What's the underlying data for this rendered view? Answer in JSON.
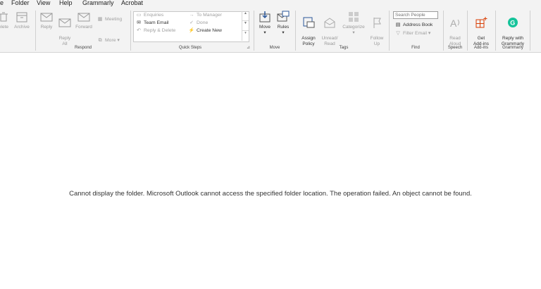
{
  "menubar": {
    "items": [
      {
        "label": "e"
      },
      {
        "label": "Folder"
      },
      {
        "label": "View"
      },
      {
        "label": "Help"
      },
      {
        "label": "Grammarly"
      },
      {
        "label": "Acrobat"
      }
    ]
  },
  "ribbon": {
    "delete": {
      "delete_label": "elete",
      "archive_label": "Archive"
    },
    "respond": {
      "reply_label": "Reply",
      "reply_all_label": "Reply\nAll",
      "forward_label": "Forward",
      "meeting_label": "Meeting",
      "more_label": "More",
      "group_label": "Respond"
    },
    "quick_steps": {
      "items": [
        {
          "label": "Enquiries"
        },
        {
          "label": "Team Email"
        },
        {
          "label": "Reply & Delete"
        },
        {
          "label": "To Manager"
        },
        {
          "label": "Done"
        },
        {
          "label": "Create New"
        }
      ],
      "group_label": "Quick Steps"
    },
    "move": {
      "move_label": "Move",
      "rules_label": "Rules",
      "group_label": "Move"
    },
    "tags": {
      "assign_policy_label": "Assign\nPolicy",
      "unread_read_label": "Unread/\nRead",
      "categorize_label": "Categorize",
      "follow_up_label": "Follow\nUp",
      "group_label": "Tags"
    },
    "find": {
      "search_people_placeholder": "Search People",
      "address_book_label": "Address Book",
      "filter_email_label": "Filter Email",
      "group_label": "Find"
    },
    "speech": {
      "read_aloud_label": "Read\nAloud",
      "group_label": "Speech"
    },
    "addins": {
      "get_addins_label": "Get\nAdd-ins",
      "group_label": "Add-ins"
    },
    "grammarly": {
      "reply_label": "Reply with\nGrammarly",
      "group_label": "Grammarly"
    }
  },
  "main": {
    "message": "Cannot display the folder. Microsoft Outlook cannot access the specified folder location. The operation failed. An object cannot be found."
  },
  "colors": {
    "ribbon_bg": "#f3f3f3",
    "accent_blue": "#2b579a",
    "addins_red": "#d83b01",
    "grammarly_green": "#15c39a"
  }
}
